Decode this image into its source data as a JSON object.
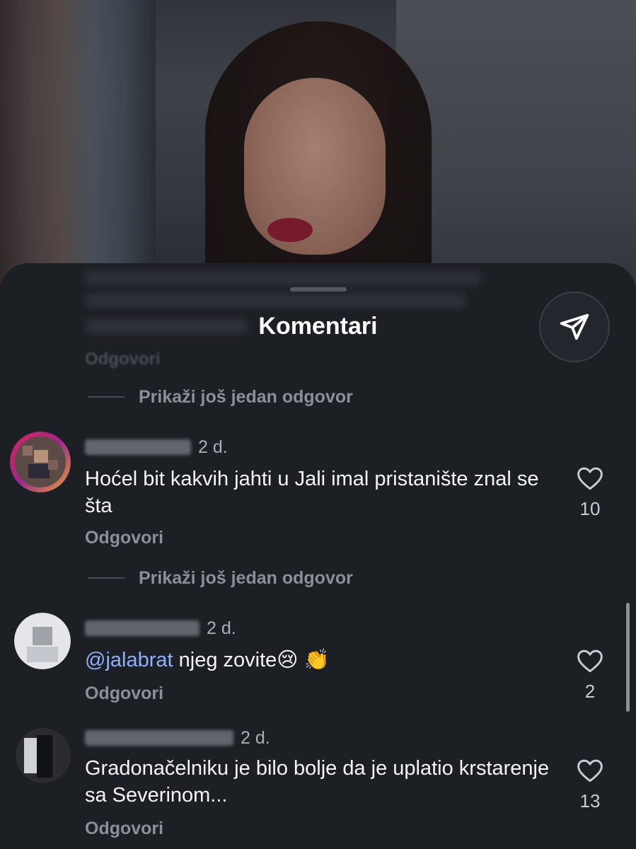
{
  "sheet": {
    "title": "Komentari",
    "send_icon": "paper-plane-icon"
  },
  "faded_comment": {
    "reply_label": "Odgovori"
  },
  "show_more_1": "Prikaži još jedan odgovor",
  "show_more_2": "Prikaži još jedan odgovor",
  "comments": [
    {
      "time": "2 d.",
      "text": "Hoćel bit kakvih jahti u Jali imal pristanište znal se šta",
      "reply": "Odgovori",
      "likes": "10"
    },
    {
      "time": "2 d.",
      "mention": "@jalabrat",
      "text": " njeg zovite😢 👏",
      "reply": "Odgovori",
      "likes": "2"
    },
    {
      "time": "2 d.",
      "text": "Gradonačelniku je bilo bolje da je uplatio krstarenje sa Severinom...",
      "reply": "Odgovori",
      "likes": "13"
    }
  ],
  "colors": {
    "background": "#1c1f24",
    "mention": "#8fb0ff",
    "secondary_text": "#8a9098"
  }
}
